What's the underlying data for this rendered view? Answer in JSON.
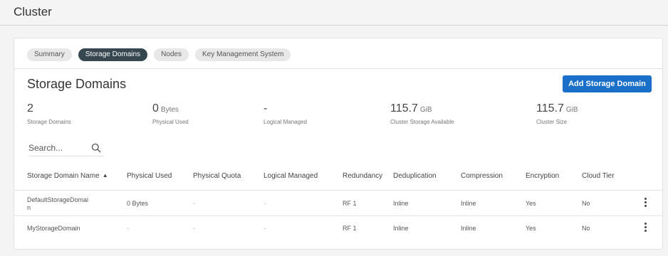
{
  "header": {
    "title": "Cluster"
  },
  "tabs": [
    {
      "label": "Summary",
      "active": false
    },
    {
      "label": "Storage Domains",
      "active": true
    },
    {
      "label": "Nodes",
      "active": false
    },
    {
      "label": "Key Management System",
      "active": false
    }
  ],
  "section": {
    "title": "Storage Domains",
    "add_button": "Add Storage Domain"
  },
  "stats": [
    {
      "value": "2",
      "unit": "",
      "label": "Storage Domains"
    },
    {
      "value": "0",
      "unit": "Bytes",
      "label": "Physical Used"
    },
    {
      "value": "-",
      "unit": "",
      "label": "Logical Managed"
    },
    {
      "value": "115.7",
      "unit": "GiB",
      "label": "Cluster Storage Available"
    },
    {
      "value": "115.7",
      "unit": "GiB",
      "label": "Cluster Size"
    }
  ],
  "search": {
    "placeholder": "Search..."
  },
  "table": {
    "columns": [
      "Storage Domain Name",
      "Physical Used",
      "Physical Quota",
      "Logical Managed",
      "Redundancy",
      "Deduplication",
      "Compression",
      "Encryption",
      "Cloud Tier"
    ],
    "rows": [
      {
        "name_line1": "DefaultStorageDomai",
        "name_line2": "n",
        "physical_used": "0 Bytes",
        "physical_quota": "-",
        "logical_managed": "-",
        "redundancy": "RF 1",
        "deduplication": "Inline",
        "compression": "Inline",
        "encryption": "Yes",
        "cloud_tier": "No"
      },
      {
        "name_line1": "MyStorageDomain",
        "name_line2": "",
        "physical_used": "-",
        "physical_quota": "-",
        "logical_managed": "-",
        "redundancy": "RF 1",
        "deduplication": "Inline",
        "compression": "Inline",
        "encryption": "Yes",
        "cloud_tier": "No"
      }
    ]
  },
  "colors": {
    "accent": "#1a6fc9",
    "active_tab": "#36474f"
  }
}
